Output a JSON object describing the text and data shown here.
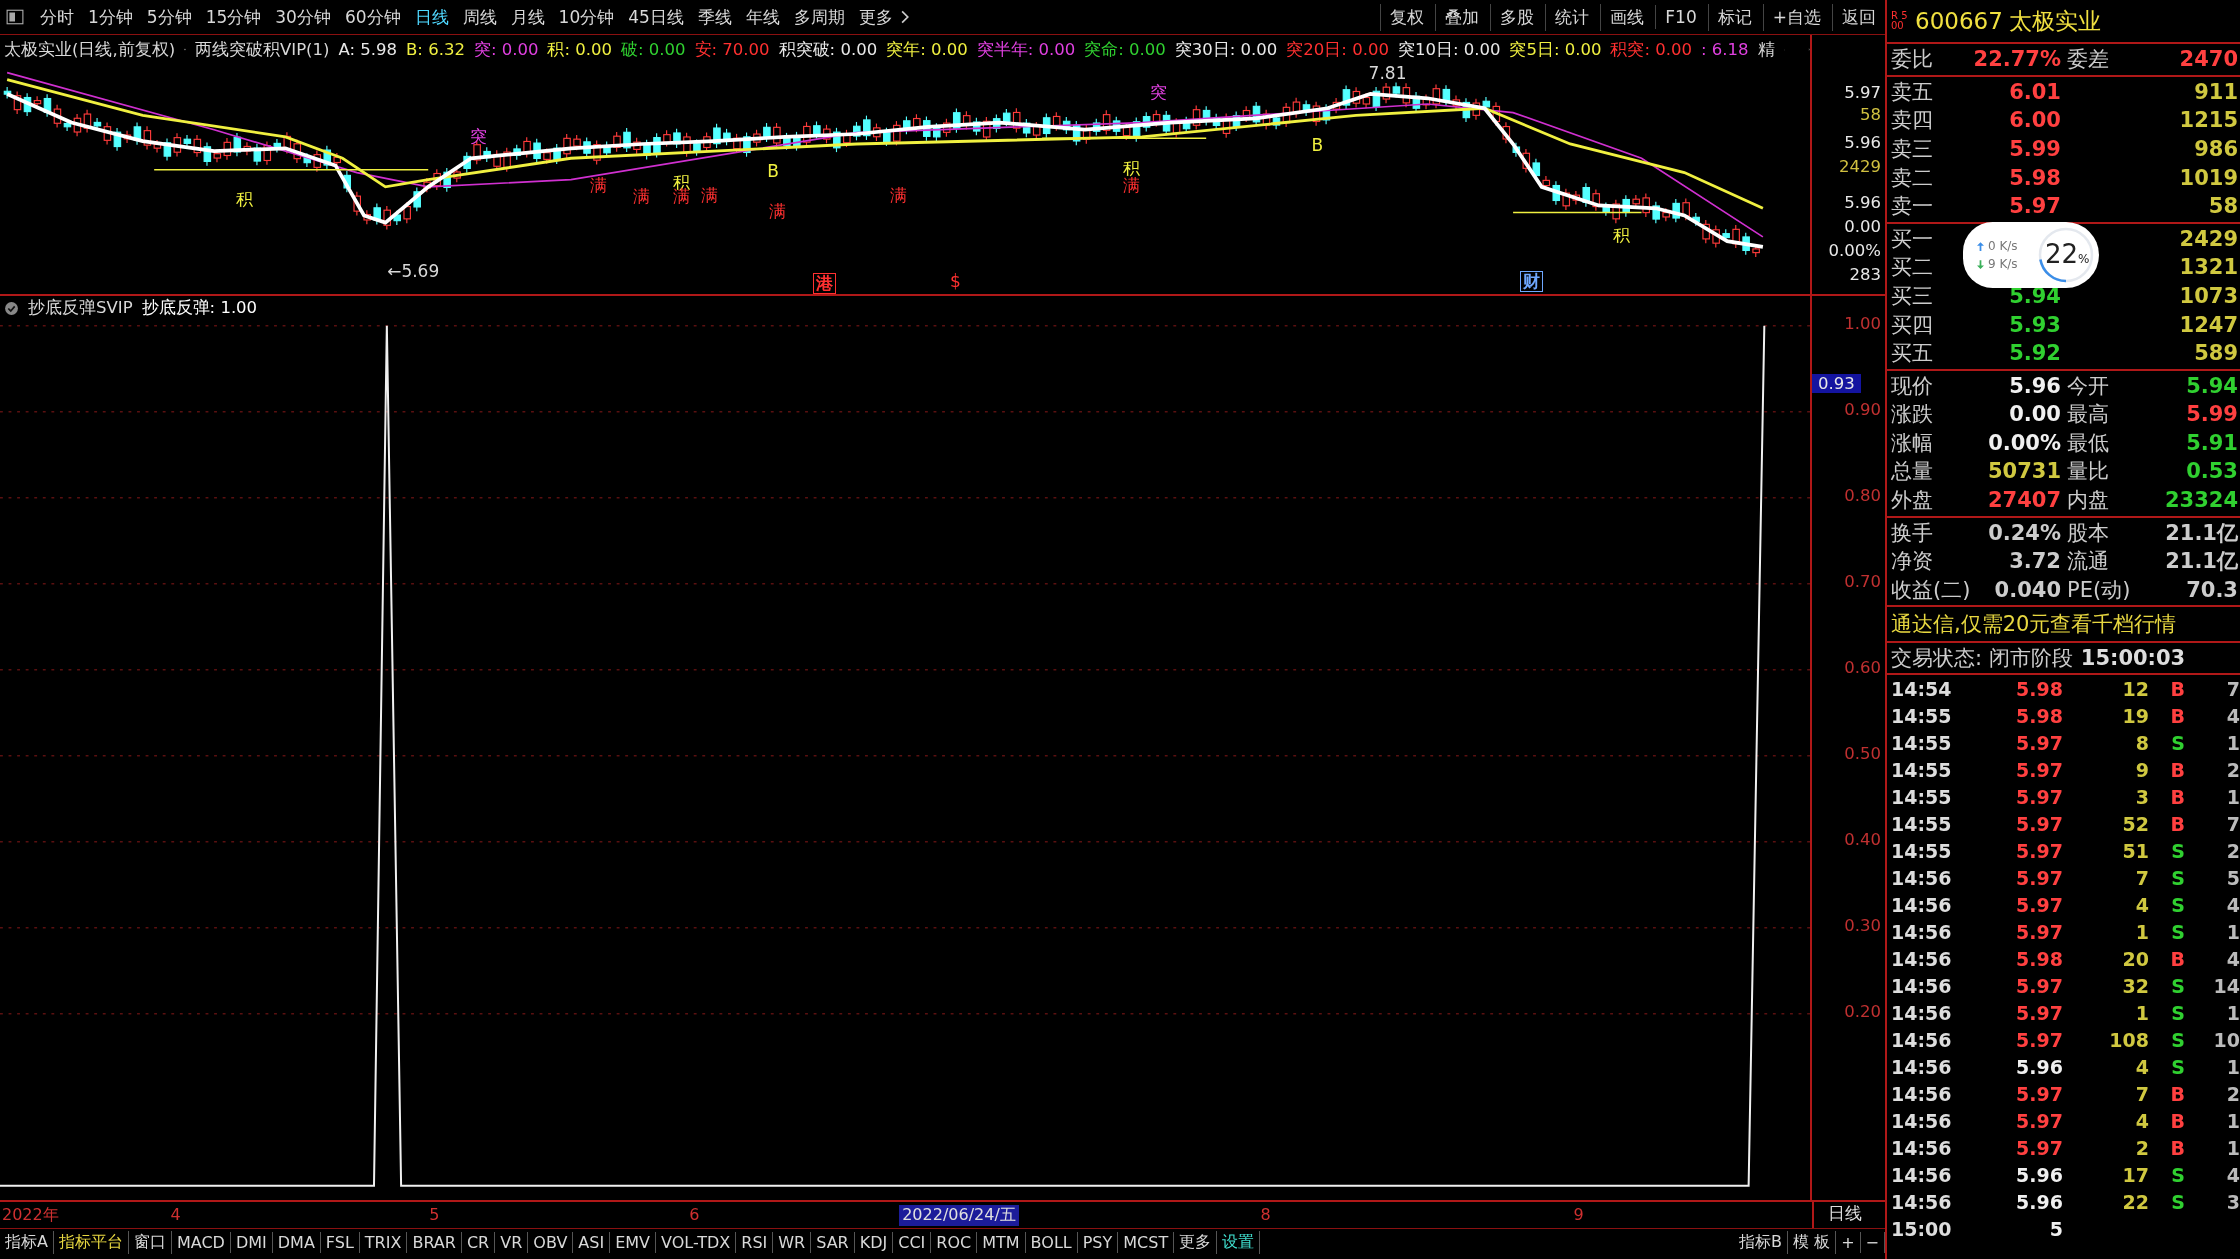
{
  "toolbar": {
    "periods": [
      {
        "label": "分时",
        "selected": false
      },
      {
        "label": "1分钟",
        "selected": false
      },
      {
        "label": "5分钟",
        "selected": false
      },
      {
        "label": "15分钟",
        "selected": false
      },
      {
        "label": "30分钟",
        "selected": false
      },
      {
        "label": "60分钟",
        "selected": false
      },
      {
        "label": "日线",
        "selected": true
      },
      {
        "label": "周线",
        "selected": false
      },
      {
        "label": "月线",
        "selected": false
      },
      {
        "label": "10分钟",
        "selected": false
      },
      {
        "label": "45日线",
        "selected": false
      },
      {
        "label": "季线",
        "selected": false
      },
      {
        "label": "年线",
        "selected": false
      },
      {
        "label": "多周期",
        "selected": false
      },
      {
        "label": "更多",
        "selected": false
      }
    ],
    "actions": [
      "复权",
      "叠加",
      "多股",
      "统计",
      "画线",
      "F10",
      "标记",
      "+自选",
      "返回"
    ]
  },
  "main_chart": {
    "title": "太极实业(日线,前复权)",
    "indicator": "两线突破积VIP(1)",
    "values": [
      {
        "text": "A: 5.98",
        "color": "#e8e8e8"
      },
      {
        "text": "B: 6.32",
        "color": "#f0f040"
      },
      {
        "text": "突: 0.00",
        "color": "#e040e0"
      },
      {
        "text": "积: 0.00",
        "color": "#f0f040"
      },
      {
        "text": "破: 0.00",
        "color": "#30d030"
      },
      {
        "text": "安: 70.00",
        "color": "#ff3030"
      },
      {
        "text": "积突破: 0.00",
        "color": "#e8e8e8"
      },
      {
        "text": "突年: 0.00",
        "color": "#f0f040"
      },
      {
        "text": "突半年: 0.00",
        "color": "#e040e0"
      },
      {
        "text": "突命: 0.00",
        "color": "#30d030"
      },
      {
        "text": "突30日: 0.00",
        "color": "#e8e8e8"
      },
      {
        "text": "突20日: 0.00",
        "color": "#ff3030"
      },
      {
        "text": "突10日: 0.00",
        "color": "#e8e8e8"
      },
      {
        "text": "突5日: 0.00",
        "color": "#f0f040"
      },
      {
        "text": "积突: 0.00",
        "color": "#ff3030"
      },
      {
        "text": ": 6.18",
        "color": "#e040e0"
      }
    ],
    "precision": "精",
    "markers": [
      {
        "text": "积",
        "color": "#f0f040",
        "kind": "plain"
      },
      {
        "text": "突",
        "color": "#e040e0",
        "kind": "plain"
      },
      {
        "text": "满",
        "color": "#ff3030",
        "kind": "plain"
      },
      {
        "text": "满",
        "color": "#ff3030",
        "kind": "plain"
      },
      {
        "text": "积",
        "color": "#f0f040",
        "kind": "plain"
      },
      {
        "text": "满",
        "color": "#ff3030",
        "kind": "plain"
      },
      {
        "text": "满",
        "color": "#ff3030",
        "kind": "plain"
      },
      {
        "text": "满",
        "color": "#ff3030",
        "kind": "plain"
      },
      {
        "text": "满",
        "color": "#ff3030",
        "kind": "plain"
      },
      {
        "text": "B",
        "color": "#f0f040",
        "kind": "plain"
      },
      {
        "text": "突",
        "color": "#e040e0",
        "kind": "plain"
      },
      {
        "text": "积",
        "color": "#f0f040",
        "kind": "plain"
      },
      {
        "text": "满",
        "color": "#ff3030",
        "kind": "plain"
      },
      {
        "text": "B",
        "color": "#f0f040",
        "kind": "plain"
      },
      {
        "text": "积",
        "color": "#f0f040",
        "kind": "plain"
      },
      {
        "text": "港",
        "color": "#ff3030",
        "kind": "boxed"
      },
      {
        "text": "$",
        "color": "#ff3030",
        "kind": "plain"
      },
      {
        "text": "财",
        "color": "#6fa8ff",
        "kind": "boxed"
      },
      {
        "text": "←5.69",
        "color": "#d8d8d8",
        "kind": "plain"
      },
      {
        "text": "7.81",
        "color": "#d8d8d8",
        "kind": "plain"
      }
    ],
    "axis_labels": [
      {
        "text": "5.97",
        "color": "#e8e8e8"
      },
      {
        "text": "58",
        "color": "#d0c040"
      },
      {
        "text": "5.96",
        "color": "#e8e8e8"
      },
      {
        "text": "2429",
        "color": "#d0c040"
      },
      {
        "text": "5.96",
        "color": "#e8e8e8"
      },
      {
        "text": "0.00",
        "color": "#e8e8e8"
      },
      {
        "text": "0.00%",
        "color": "#e8e8e8"
      },
      {
        "text": "283",
        "color": "#e8e8e8"
      }
    ]
  },
  "sub_chart": {
    "indicator": "抄底反弹SVIP",
    "value": "抄底反弹: 1.00",
    "current": "0.93",
    "yticks": [
      "1.00",
      "0.90",
      "0.80",
      "0.70",
      "0.60",
      "0.50",
      "0.40",
      "0.30",
      "0.20"
    ]
  },
  "date_axis": {
    "labels": [
      {
        "text": "2022年",
        "selected": false
      },
      {
        "text": "4",
        "selected": false
      },
      {
        "text": "5",
        "selected": false
      },
      {
        "text": "6",
        "selected": false
      },
      {
        "text": "2022/06/24/五",
        "selected": true
      },
      {
        "text": "8",
        "selected": false
      },
      {
        "text": "9",
        "selected": false
      }
    ],
    "period": "日线"
  },
  "indicator_tabs": [
    {
      "label": "指标A",
      "kind": "plain"
    },
    {
      "label": "指标平台",
      "kind": "highlight"
    },
    {
      "label": "窗口",
      "kind": "plain"
    },
    {
      "label": "MACD",
      "kind": "plain"
    },
    {
      "label": "DMI",
      "kind": "plain"
    },
    {
      "label": "DMA",
      "kind": "plain"
    },
    {
      "label": "FSL",
      "kind": "plain"
    },
    {
      "label": "TRIX",
      "kind": "plain"
    },
    {
      "label": "BRAR",
      "kind": "plain"
    },
    {
      "label": "CR",
      "kind": "plain"
    },
    {
      "label": "VR",
      "kind": "plain"
    },
    {
      "label": "OBV",
      "kind": "plain"
    },
    {
      "label": "ASI",
      "kind": "plain"
    },
    {
      "label": "EMV",
      "kind": "plain"
    },
    {
      "label": "VOL-TDX",
      "kind": "plain"
    },
    {
      "label": "RSI",
      "kind": "plain"
    },
    {
      "label": "WR",
      "kind": "plain"
    },
    {
      "label": "SAR",
      "kind": "plain"
    },
    {
      "label": "KDJ",
      "kind": "plain"
    },
    {
      "label": "CCI",
      "kind": "plain"
    },
    {
      "label": "ROC",
      "kind": "plain"
    },
    {
      "label": "MTM",
      "kind": "plain"
    },
    {
      "label": "BOLL",
      "kind": "plain"
    },
    {
      "label": "PSY",
      "kind": "plain"
    },
    {
      "label": "MCST",
      "kind": "plain"
    },
    {
      "label": "更多",
      "kind": "plain"
    },
    {
      "label": "设置",
      "kind": "settings"
    }
  ],
  "indicator_tabs_right": [
    "指标B",
    "模 板",
    "+",
    "−"
  ],
  "quote": {
    "badge": "R 500",
    "code": "600667",
    "name": "太极实业",
    "ratio": [
      {
        "label": "委比",
        "value": "22.77%"
      },
      {
        "label": "委差",
        "value": "2470"
      }
    ],
    "sell": [
      {
        "label": "卖五",
        "price": "6.01",
        "volume": "911"
      },
      {
        "label": "卖四",
        "price": "6.00",
        "volume": "1215"
      },
      {
        "label": "卖三",
        "price": "5.99",
        "volume": "986"
      },
      {
        "label": "卖二",
        "price": "5.98",
        "volume": "1019"
      },
      {
        "label": "卖一",
        "price": "5.97",
        "volume": "58"
      }
    ],
    "buy": [
      {
        "label": "买一",
        "volume": "2429"
      },
      {
        "label": "买二",
        "volume": "1321"
      },
      {
        "label": "买三",
        "price": "5.94",
        "volume": "1073"
      },
      {
        "label": "买四",
        "price": "5.93",
        "volume": "1247"
      },
      {
        "label": "买五",
        "price": "5.92",
        "volume": "589"
      }
    ],
    "stats": [
      {
        "label": "现价",
        "value": "5.96",
        "color": "#f0f0f0"
      },
      {
        "label": "今开",
        "value": "5.94",
        "color": "#30d030"
      },
      {
        "label": "涨跌",
        "value": "0.00",
        "color": "#f0f0f0"
      },
      {
        "label": "最高",
        "value": "5.99",
        "color": "#ff4040"
      },
      {
        "label": "涨幅",
        "value": "0.00%",
        "color": "#f0f0f0"
      },
      {
        "label": "最低",
        "value": "5.91",
        "color": "#30d030"
      },
      {
        "label": "总量",
        "value": "50731",
        "color": "#d0c840"
      },
      {
        "label": "量比",
        "value": "0.53",
        "color": "#30d030"
      },
      {
        "label": "外盘",
        "value": "27407",
        "color": "#ff4040"
      },
      {
        "label": "内盘",
        "value": "23324",
        "color": "#30d030"
      }
    ],
    "finance": [
      {
        "label": "换手",
        "value": "0.24%"
      },
      {
        "label": "股本",
        "value": "21.1亿"
      },
      {
        "label": "净资",
        "value": "3.72"
      },
      {
        "label": "流通",
        "value": "21.1亿"
      },
      {
        "label": "收益(二)",
        "value": "0.040"
      },
      {
        "label": "PE(动)",
        "value": "70.3"
      }
    ],
    "ad": "通达信,仅需20元查看千档行情",
    "status_label": "交易状态: 闭市阶段",
    "status_time": "15:00:03",
    "trades": [
      {
        "time": "14:54",
        "price": "5.98",
        "color": "#ff4040",
        "volume": "12",
        "side": "B",
        "kind": "buy",
        "column_5": "7"
      },
      {
        "time": "14:55",
        "price": "5.98",
        "color": "#ff4040",
        "volume": "19",
        "side": "B",
        "kind": "buy",
        "column_5": "4"
      },
      {
        "time": "14:55",
        "price": "5.97",
        "color": "#ff4040",
        "volume": "8",
        "side": "S",
        "kind": "sell",
        "column_5": "1"
      },
      {
        "time": "14:55",
        "price": "5.97",
        "color": "#ff4040",
        "volume": "9",
        "side": "B",
        "kind": "buy",
        "column_5": "2"
      },
      {
        "time": "14:55",
        "price": "5.97",
        "color": "#ff4040",
        "volume": "3",
        "side": "B",
        "kind": "buy",
        "column_5": "1"
      },
      {
        "time": "14:55",
        "price": "5.97",
        "color": "#ff4040",
        "volume": "52",
        "side": "B",
        "kind": "buy",
        "column_5": "7"
      },
      {
        "time": "14:55",
        "price": "5.97",
        "color": "#ff4040",
        "volume": "51",
        "side": "S",
        "kind": "sell",
        "column_5": "2"
      },
      {
        "time": "14:56",
        "price": "5.97",
        "color": "#ff4040",
        "volume": "7",
        "side": "S",
        "kind": "sell",
        "column_5": "5"
      },
      {
        "time": "14:56",
        "price": "5.97",
        "color": "#ff4040",
        "volume": "4",
        "side": "S",
        "kind": "sell",
        "column_5": "4"
      },
      {
        "time": "14:56",
        "price": "5.97",
        "color": "#ff4040",
        "volume": "1",
        "side": "S",
        "kind": "sell",
        "column_5": "1"
      },
      {
        "time": "14:56",
        "price": "5.98",
        "color": "#ff4040",
        "volume": "20",
        "side": "B",
        "kind": "buy",
        "column_5": "4"
      },
      {
        "time": "14:56",
        "price": "5.97",
        "color": "#ff4040",
        "volume": "32",
        "side": "S",
        "kind": "sell",
        "column_5": "14"
      },
      {
        "time": "14:56",
        "price": "5.97",
        "color": "#ff4040",
        "volume": "1",
        "side": "S",
        "kind": "sell",
        "column_5": "1"
      },
      {
        "time": "14:56",
        "price": "5.97",
        "color": "#ff4040",
        "volume": "108",
        "side": "S",
        "kind": "sell",
        "column_5": "10"
      },
      {
        "time": "14:56",
        "price": "5.96",
        "color": "#f0f0f0",
        "volume": "4",
        "side": "S",
        "kind": "sell",
        "column_5": "1"
      },
      {
        "time": "14:56",
        "price": "5.97",
        "color": "#ff4040",
        "volume": "7",
        "side": "B",
        "kind": "buy",
        "column_5": "2"
      },
      {
        "time": "14:56",
        "price": "5.97",
        "color": "#ff4040",
        "volume": "4",
        "side": "B",
        "kind": "buy",
        "column_5": "1"
      },
      {
        "time": "14:56",
        "price": "5.97",
        "color": "#ff4040",
        "volume": "2",
        "side": "B",
        "kind": "buy",
        "column_5": "1"
      },
      {
        "time": "14:56",
        "price": "5.96",
        "color": "#f0f0f0",
        "volume": "17",
        "side": "S",
        "kind": "sell",
        "column_5": "4"
      },
      {
        "time": "14:56",
        "price": "5.96",
        "color": "#f0f0f0",
        "volume": "22",
        "side": "S",
        "kind": "sell",
        "column_5": "3"
      },
      {
        "time": "15:00",
        "price": "5",
        "color": "#f0f0f0"
      }
    ]
  },
  "network_widget": {
    "upload": "0 K/s",
    "download": "9 K/s",
    "percent": "22",
    "unit": "%",
    "level": 0.22
  }
}
